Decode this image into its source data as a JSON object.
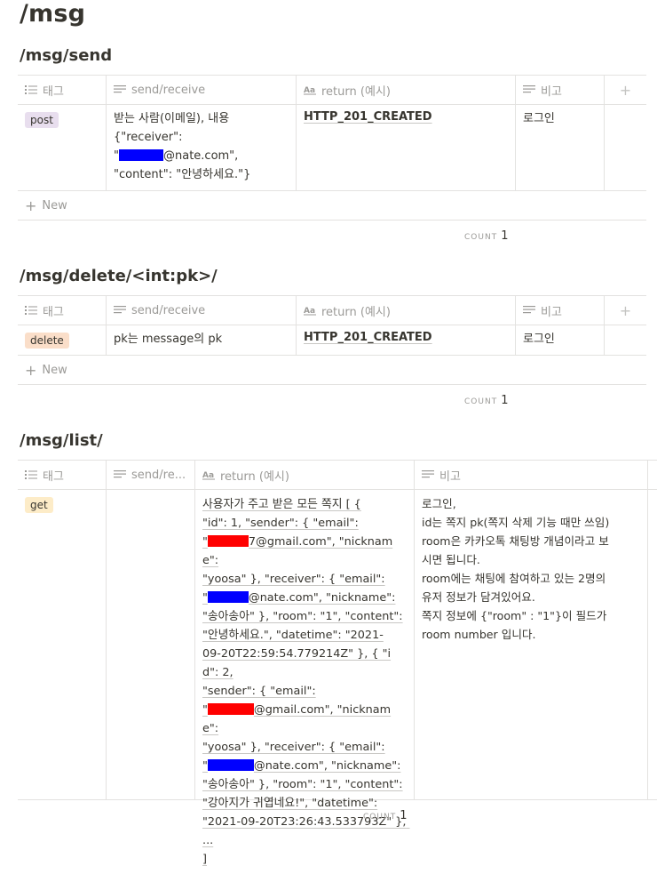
{
  "page": {
    "title": "/msg"
  },
  "headers": {
    "tag": "태그",
    "send_receive": "send/receive",
    "send_receive_short": "send/re...",
    "return": "return (예시)",
    "note": "비고",
    "add_column": "+"
  },
  "new_row_label": "New",
  "count_label": "COUNT",
  "sections": [
    {
      "heading": "/msg/send",
      "tag": "post",
      "send_receive_1": "받는 사람(이메일), 내용\n{\"receiver\":\n\"",
      "send_receive_2": "@nate.com\",\n\"content\": \"안녕하세요.\"}",
      "return": "HTTP_201_CREATED",
      "note": "로그인",
      "count": "1"
    },
    {
      "heading": "/msg/delete/<int:pk>/",
      "tag": "delete",
      "send_receive": "pk는 message의 pk",
      "return": "HTTP_201_CREATED",
      "note": "로그인",
      "count": "1"
    },
    {
      "heading": "/msg/list/",
      "tag": "get",
      "send_receive": "",
      "return_parts": [
        "사용자가 주고 받은 모든 쪽지 [ {\n\"id\": 1, \"sender\": { \"email\":\n\"",
        "7@gmail.com\", \"nickname\":\n\"yoosa\" }, \"receiver\": { \"email\":\n\"",
        "@nate.com\", \"nickname\":\n\"송아송아\" }, \"room\": \"1\", \"content\":\n\"안녕하세요.\", \"datetime\": \"2021-\n09-20T22:59:54.779214Z\" }, { \"id\": 2,\n\"sender\": { \"email\":\n\"",
        "@gmail.com\", \"nickname\":\n\"yoosa\" }, \"receiver\": { \"email\":\n\"",
        "@nate.com\", \"nickname\":\n\"송아송아\" }, \"room\": \"1\", \"content\":\n\"강아지가 귀엽네요!\", \"datetime\":\n\"2021-09-20T23:26:43.533793Z\" }, ...\n]"
      ],
      "note": "로그인,\nid는 쪽지 pk(쪽지 삭제 기능 때만 쓰임)\nroom은 카카오톡 채팅방 개념이라고 보\n시면 됩니다.\nroom에는 채팅에 참여하고 있는 2명의\n유저 정보가 담겨있어요.\n쪽지 정보에 {\"room\" : \"1\"}이 필드가\nroom number 입니다.",
      "count": "1"
    }
  ],
  "colors": {
    "tag_post": "#e8deee",
    "tag_delete": "#fadec9",
    "tag_get": "#fdecc8",
    "redaction_blue": "#0000ff",
    "redaction_red": "#ff0000"
  }
}
